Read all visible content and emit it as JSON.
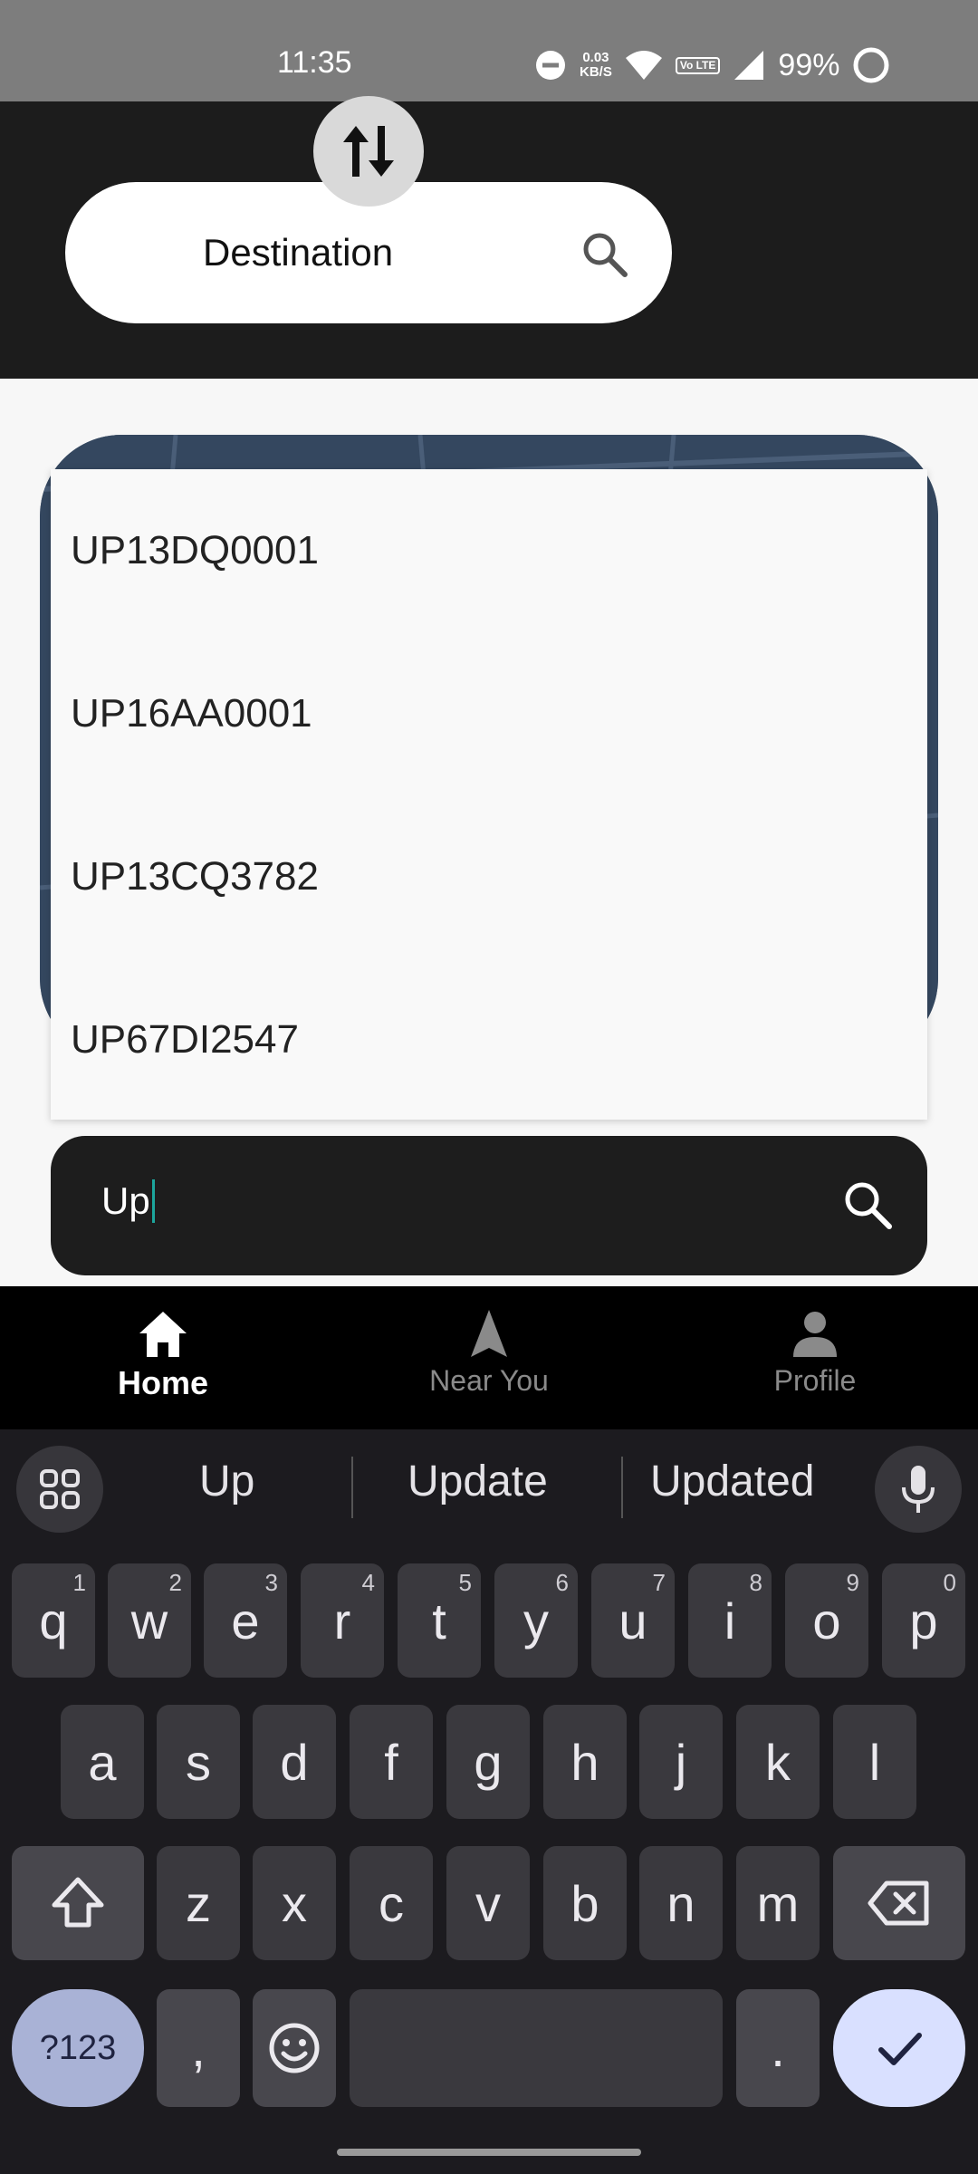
{
  "status_bar": {
    "time": "11:35",
    "net_speed_value": "0.03",
    "net_speed_unit": "KB/S",
    "volte_label": "Vo LTE",
    "battery": "99%",
    "icons": [
      "dnd-icon",
      "wifi-icon",
      "volte-icon",
      "signal-icon",
      "battery-icon"
    ]
  },
  "header": {
    "swap_icon": "swap-vertical-icon",
    "destination_label": "Destination",
    "destination_icon": "search-icon"
  },
  "dropdown": {
    "items": [
      "UP13DQ0001",
      "UP16AA0001",
      "UP13CQ3782",
      "UP67DI2547"
    ]
  },
  "search": {
    "value": "Up",
    "icon": "search-icon"
  },
  "bottom_nav": {
    "items": [
      {
        "label": "Home",
        "icon": "home-icon",
        "active": true
      },
      {
        "label": "Near You",
        "icon": "navigation-arrow-icon",
        "active": false
      },
      {
        "label": "Profile",
        "icon": "person-icon",
        "active": false
      }
    ]
  },
  "keyboard": {
    "suggestions": [
      "Up",
      "Update",
      "Updated"
    ],
    "row1": [
      {
        "key": "q",
        "hint": "1"
      },
      {
        "key": "w",
        "hint": "2"
      },
      {
        "key": "e",
        "hint": "3"
      },
      {
        "key": "r",
        "hint": "4"
      },
      {
        "key": "t",
        "hint": "5"
      },
      {
        "key": "y",
        "hint": "6"
      },
      {
        "key": "u",
        "hint": "7"
      },
      {
        "key": "i",
        "hint": "8"
      },
      {
        "key": "o",
        "hint": "9"
      },
      {
        "key": "p",
        "hint": "0"
      }
    ],
    "row2": [
      "a",
      "s",
      "d",
      "f",
      "g",
      "h",
      "j",
      "k",
      "l"
    ],
    "row3": [
      "z",
      "x",
      "c",
      "v",
      "b",
      "n",
      "m"
    ],
    "symbols_label": "?123",
    "comma": ",",
    "period": "."
  },
  "colors": {
    "accent_caret": "#1ca59c",
    "header_bg": "#1c1c1c",
    "enter_key": "#d9e0ff",
    "symbol_key": "#a9b2d6"
  }
}
